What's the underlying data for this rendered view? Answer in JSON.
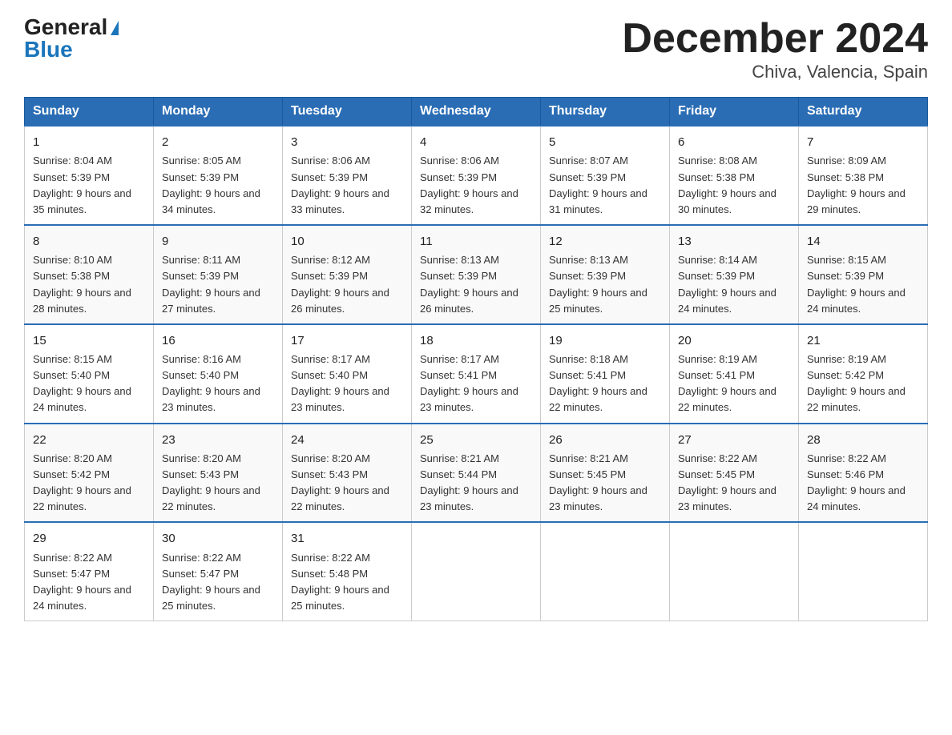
{
  "header": {
    "logo_general": "General",
    "logo_blue": "Blue",
    "title": "December 2024",
    "subtitle": "Chiva, Valencia, Spain"
  },
  "days_of_week": [
    "Sunday",
    "Monday",
    "Tuesday",
    "Wednesday",
    "Thursday",
    "Friday",
    "Saturday"
  ],
  "weeks": [
    [
      {
        "day": "1",
        "sunrise": "8:04 AM",
        "sunset": "5:39 PM",
        "daylight": "9 hours and 35 minutes."
      },
      {
        "day": "2",
        "sunrise": "8:05 AM",
        "sunset": "5:39 PM",
        "daylight": "9 hours and 34 minutes."
      },
      {
        "day": "3",
        "sunrise": "8:06 AM",
        "sunset": "5:39 PM",
        "daylight": "9 hours and 33 minutes."
      },
      {
        "day": "4",
        "sunrise": "8:06 AM",
        "sunset": "5:39 PM",
        "daylight": "9 hours and 32 minutes."
      },
      {
        "day": "5",
        "sunrise": "8:07 AM",
        "sunset": "5:39 PM",
        "daylight": "9 hours and 31 minutes."
      },
      {
        "day": "6",
        "sunrise": "8:08 AM",
        "sunset": "5:38 PM",
        "daylight": "9 hours and 30 minutes."
      },
      {
        "day": "7",
        "sunrise": "8:09 AM",
        "sunset": "5:38 PM",
        "daylight": "9 hours and 29 minutes."
      }
    ],
    [
      {
        "day": "8",
        "sunrise": "8:10 AM",
        "sunset": "5:38 PM",
        "daylight": "9 hours and 28 minutes."
      },
      {
        "day": "9",
        "sunrise": "8:11 AM",
        "sunset": "5:39 PM",
        "daylight": "9 hours and 27 minutes."
      },
      {
        "day": "10",
        "sunrise": "8:12 AM",
        "sunset": "5:39 PM",
        "daylight": "9 hours and 26 minutes."
      },
      {
        "day": "11",
        "sunrise": "8:13 AM",
        "sunset": "5:39 PM",
        "daylight": "9 hours and 26 minutes."
      },
      {
        "day": "12",
        "sunrise": "8:13 AM",
        "sunset": "5:39 PM",
        "daylight": "9 hours and 25 minutes."
      },
      {
        "day": "13",
        "sunrise": "8:14 AM",
        "sunset": "5:39 PM",
        "daylight": "9 hours and 24 minutes."
      },
      {
        "day": "14",
        "sunrise": "8:15 AM",
        "sunset": "5:39 PM",
        "daylight": "9 hours and 24 minutes."
      }
    ],
    [
      {
        "day": "15",
        "sunrise": "8:15 AM",
        "sunset": "5:40 PM",
        "daylight": "9 hours and 24 minutes."
      },
      {
        "day": "16",
        "sunrise": "8:16 AM",
        "sunset": "5:40 PM",
        "daylight": "9 hours and 23 minutes."
      },
      {
        "day": "17",
        "sunrise": "8:17 AM",
        "sunset": "5:40 PM",
        "daylight": "9 hours and 23 minutes."
      },
      {
        "day": "18",
        "sunrise": "8:17 AM",
        "sunset": "5:41 PM",
        "daylight": "9 hours and 23 minutes."
      },
      {
        "day": "19",
        "sunrise": "8:18 AM",
        "sunset": "5:41 PM",
        "daylight": "9 hours and 22 minutes."
      },
      {
        "day": "20",
        "sunrise": "8:19 AM",
        "sunset": "5:41 PM",
        "daylight": "9 hours and 22 minutes."
      },
      {
        "day": "21",
        "sunrise": "8:19 AM",
        "sunset": "5:42 PM",
        "daylight": "9 hours and 22 minutes."
      }
    ],
    [
      {
        "day": "22",
        "sunrise": "8:20 AM",
        "sunset": "5:42 PM",
        "daylight": "9 hours and 22 minutes."
      },
      {
        "day": "23",
        "sunrise": "8:20 AM",
        "sunset": "5:43 PM",
        "daylight": "9 hours and 22 minutes."
      },
      {
        "day": "24",
        "sunrise": "8:20 AM",
        "sunset": "5:43 PM",
        "daylight": "9 hours and 22 minutes."
      },
      {
        "day": "25",
        "sunrise": "8:21 AM",
        "sunset": "5:44 PM",
        "daylight": "9 hours and 23 minutes."
      },
      {
        "day": "26",
        "sunrise": "8:21 AM",
        "sunset": "5:45 PM",
        "daylight": "9 hours and 23 minutes."
      },
      {
        "day": "27",
        "sunrise": "8:22 AM",
        "sunset": "5:45 PM",
        "daylight": "9 hours and 23 minutes."
      },
      {
        "day": "28",
        "sunrise": "8:22 AM",
        "sunset": "5:46 PM",
        "daylight": "9 hours and 24 minutes."
      }
    ],
    [
      {
        "day": "29",
        "sunrise": "8:22 AM",
        "sunset": "5:47 PM",
        "daylight": "9 hours and 24 minutes."
      },
      {
        "day": "30",
        "sunrise": "8:22 AM",
        "sunset": "5:47 PM",
        "daylight": "9 hours and 25 minutes."
      },
      {
        "day": "31",
        "sunrise": "8:22 AM",
        "sunset": "5:48 PM",
        "daylight": "9 hours and 25 minutes."
      },
      null,
      null,
      null,
      null
    ]
  ],
  "sunrise_label": "Sunrise:",
  "sunset_label": "Sunset:",
  "daylight_label": "Daylight:"
}
